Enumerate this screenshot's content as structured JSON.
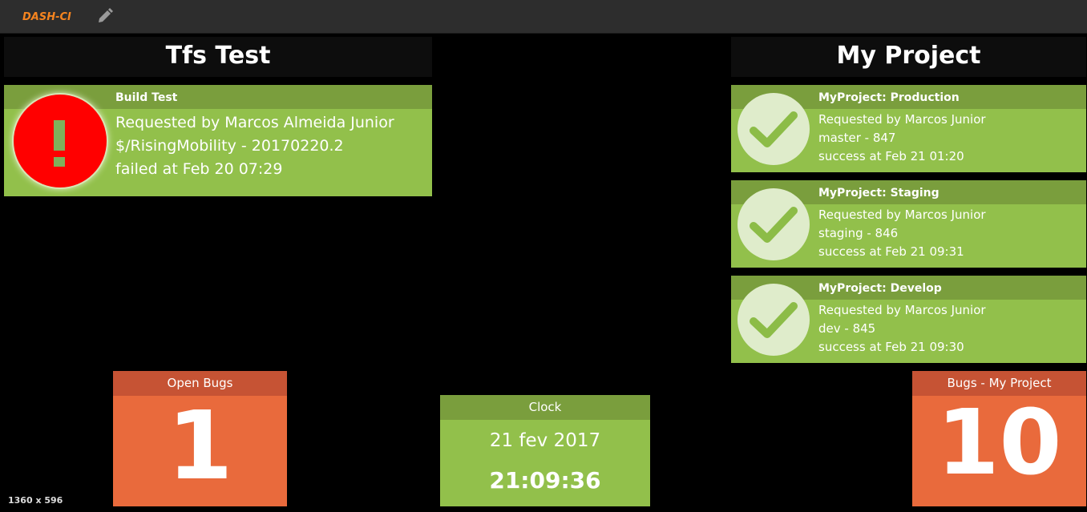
{
  "app": {
    "brand": "DASH-CI",
    "edit_icon": "pencil-icon"
  },
  "columns": [
    {
      "title": "Tfs Test"
    },
    {
      "title": "My Project"
    }
  ],
  "tfs_build": {
    "name": "Build Test",
    "requested": "Requested by Marcos Almeida Junior",
    "source": "$/RisingMobility - 20170220.2",
    "status": "failed at Feb 20 07:29",
    "icon": "error-exclamation-icon",
    "status_color": "#ff0000"
  },
  "project_builds": [
    {
      "name": "MyProject: Production",
      "requested": "Requested by Marcos Junior",
      "branch": "master - 847",
      "status": "success at Feb 21 01:20",
      "icon": "checkmark-icon"
    },
    {
      "name": "MyProject: Staging",
      "requested": "Requested by Marcos Junior",
      "branch": "staging - 846",
      "status": "success at Feb 21 09:31",
      "icon": "checkmark-icon"
    },
    {
      "name": "MyProject: Develop",
      "requested": "Requested by Marcos Junior",
      "branch": "dev - 845",
      "status": "success at Feb 21 09:30",
      "icon": "checkmark-icon"
    }
  ],
  "open_bugs": {
    "title": "Open Bugs",
    "value": "1"
  },
  "bugs_project": {
    "title": "Bugs - My Project",
    "value": "10"
  },
  "clock": {
    "title": "Clock",
    "date": "21 fev 2017",
    "time": "21:09:36"
  },
  "resolution_label": "1360 x 596",
  "colors": {
    "success_green": "#92c04b",
    "success_header": "#7a9e3d",
    "bug_orange": "#e96a3c",
    "bug_header": "#c65334",
    "brand_orange": "#f5841f"
  }
}
